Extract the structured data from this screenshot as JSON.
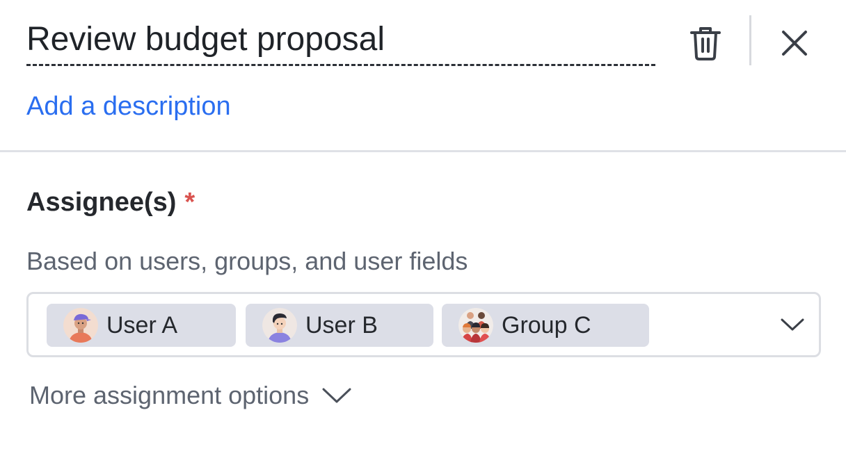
{
  "header": {
    "title": "Review budget proposal",
    "delete_icon": "trash-icon",
    "close_icon": "close-icon"
  },
  "description": {
    "link_label": "Add a description"
  },
  "assignees": {
    "label": "Assignee(s)",
    "required_marker": "*",
    "helper_text": "Based on users, groups, and user fields",
    "chips": [
      {
        "label": "User A",
        "avatar_icon": "user-avatar-icon"
      },
      {
        "label": "User B",
        "avatar_icon": "user-avatar-icon"
      },
      {
        "label": "Group C",
        "avatar_icon": "group-avatar-icon"
      }
    ],
    "dropdown_icon": "chevron-down-icon"
  },
  "more_options": {
    "label": "More assignment options",
    "icon": "chevron-down-icon"
  },
  "colors": {
    "link": "#2a6ef0",
    "required": "#d9534f",
    "chip_background": "#dcdee7",
    "text_primary": "#25282d",
    "text_secondary": "#5d6470",
    "border": "#dcdee3"
  }
}
